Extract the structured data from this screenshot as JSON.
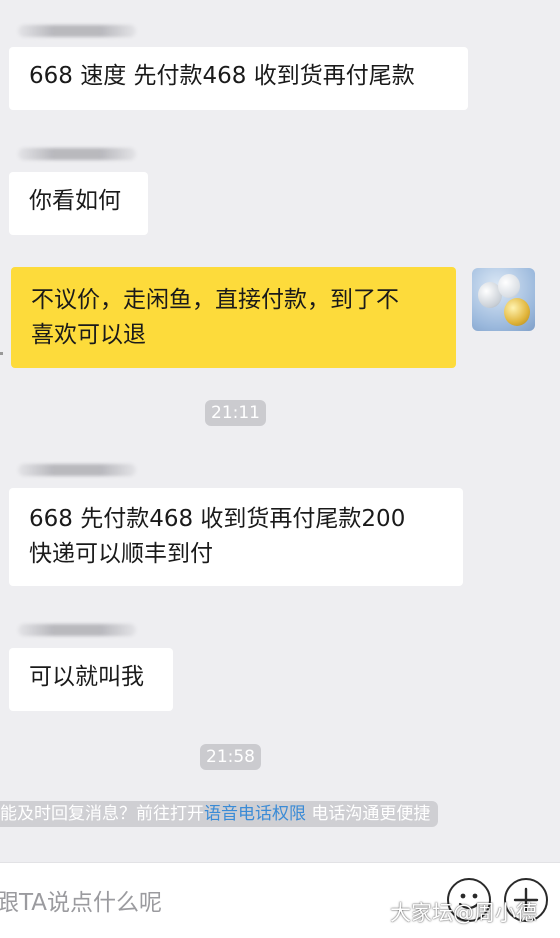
{
  "messages": [
    {
      "text": "668 速度 先付款468 收到货再付尾款"
    },
    {
      "text": "你看如何"
    },
    {
      "text": "不议价，走闲鱼，直接付款，到了不\n喜欢可以退"
    },
    {
      "text": "668 先付款468 收到货再付尾款200\n快递可以顺丰到付"
    },
    {
      "text": "可以就叫我"
    }
  ],
  "timestamps": [
    "21:11",
    "21:58"
  ],
  "notice": {
    "prefix": "能及时回复消息？前往打开",
    "link": "语音电话权限",
    "suffix": " 电话沟通更便捷"
  },
  "input": {
    "placeholder": "想跟TA说点什么呢"
  },
  "icons": {
    "emoji": "smiley-icon",
    "more": "plus-icon"
  },
  "watermark": "大家坛@周小德",
  "colors": {
    "mine_bubble": "#fddb3b",
    "other_bubble": "#ffffff",
    "link": "#3a8bd6"
  }
}
